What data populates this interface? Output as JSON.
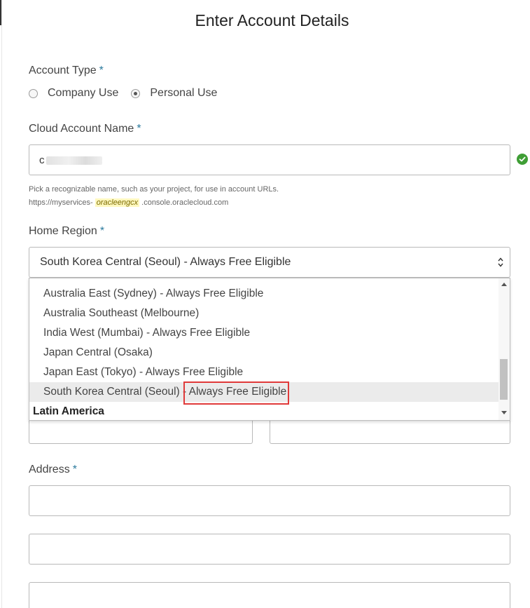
{
  "page": {
    "title": "Enter Account Details"
  },
  "account_type": {
    "label": "Account Type",
    "required_mark": "*",
    "options": [
      {
        "label": "Company Use",
        "checked": false
      },
      {
        "label": "Personal Use",
        "checked": true
      }
    ]
  },
  "cloud_account_name": {
    "label": "Cloud Account Name",
    "required_mark": "*",
    "value": "c",
    "valid": true,
    "hint_line1": "Pick a recognizable name, such as your project, for use in account URLs.",
    "hint_url_prefix": "https://myservices-",
    "hint_url_highlight": "oracleengcx",
    "hint_url_suffix": ".console.oraclecloud.com"
  },
  "home_region": {
    "label": "Home Region",
    "required_mark": "*",
    "selected_value": "South Korea Central (Seoul) - Always Free Eligible",
    "dropdown_options": [
      "Australia East (Sydney) - Always Free Eligible",
      "Australia Southeast (Melbourne)",
      "India West (Mumbai) - Always Free Eligible",
      "Japan Central (Osaka)",
      "Japan East (Tokyo) - Always Free Eligible",
      "South Korea Central (Seoul) - Always Free Eligible"
    ],
    "selected_index": 5,
    "next_group": "Latin America"
  },
  "address": {
    "label": "Address",
    "required_mark": "*"
  },
  "colors": {
    "required": "#2b7a9d",
    "valid_check": "#3f9e35",
    "highlight_box": "#e03a3a"
  }
}
